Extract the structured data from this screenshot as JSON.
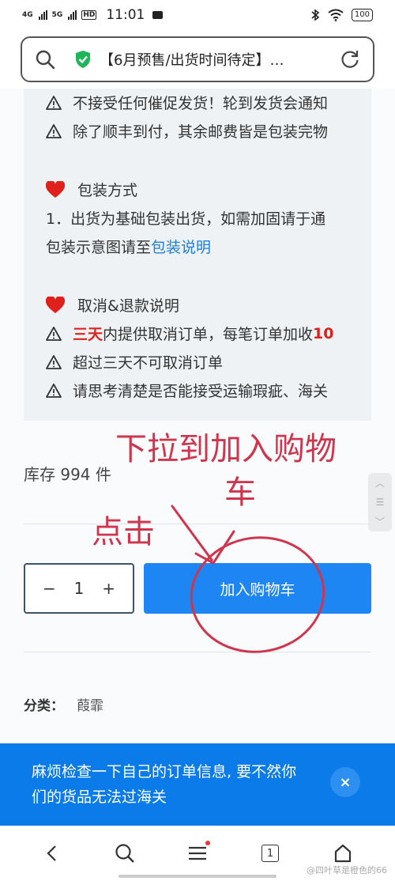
{
  "status_bar": {
    "sim1": "4G",
    "sim2": "5G",
    "hd": "HD",
    "time": "11:01",
    "battery": "100"
  },
  "address_bar": {
    "title": "【6月预售/出货时间待定】…"
  },
  "info": {
    "line1": "不接受任何催促发货！轮到发货会通知",
    "line2": "除了顺丰到付，其余邮费皆是包装完物",
    "packaging_heading": "包装方式",
    "packaging_line1": "1．出货为基础包装出货，如需加固请于通",
    "packaging_line2_prefix": "包装示意图请至",
    "packaging_link": "包装说明",
    "cancel_heading": "取消&退款说明",
    "cancel_line1_red": "三天",
    "cancel_line1_rest": "内提供取消订单，每笔订单加收",
    "cancel_line1_red2": "10",
    "cancel_line2": "超过三天不可取消订单",
    "cancel_line3": "请思考清楚是否能接受运输瑕疵、海关"
  },
  "stock_text": "库存 994 件",
  "quantity": {
    "minus": "−",
    "value": "1",
    "plus": "+"
  },
  "add_to_cart_label": "加入购物车",
  "category": {
    "label": "分类：",
    "value": "葭霏"
  },
  "annotations": {
    "pull_down_line1": "下拉到加入购物",
    "pull_down_line2": "车",
    "click": "点击",
    "color": "#d0354e"
  },
  "notice": {
    "text_line1": "麻烦检查一下自己的订单信息, 要不然你",
    "text_line2": "们的货品无法过海关",
    "close": "×"
  },
  "nav": {
    "tab_count": "1"
  },
  "watermark": "@四叶草是橙色的66"
}
